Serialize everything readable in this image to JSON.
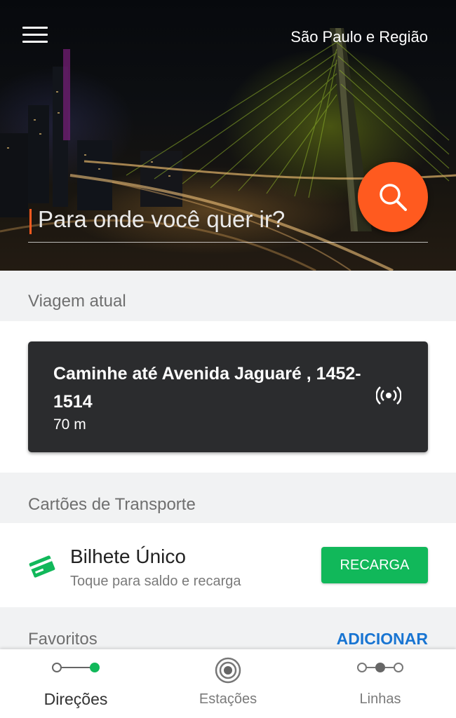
{
  "header": {
    "menu_icon": "hamburger-menu-icon",
    "region": "São Paulo e Região"
  },
  "search": {
    "placeholder": "Para onde você quer ir?",
    "button_icon": "search-icon",
    "accent": "#ff5a1f"
  },
  "current_trip": {
    "section_title": "Viagem atual",
    "instruction": "Caminhe até Avenida Jaguaré , 1452-1514",
    "distance": "70 m",
    "icon": "broadcast-icon"
  },
  "transport_cards": {
    "section_title": "Cartões de Transporte",
    "items": [
      {
        "icon": "credit-card-icon",
        "name": "Bilhete Único",
        "subtitle": "Toque para saldo e recarga",
        "action_label": "RECARGA",
        "action_color": "#11b85a"
      }
    ]
  },
  "favorites": {
    "section_title": "Favoritos",
    "add_label": "ADICIONAR",
    "link_color": "#1975d2"
  },
  "bottom_nav": {
    "items": [
      {
        "label": "Direções",
        "icon": "route-icon",
        "active": true
      },
      {
        "label": "Estações",
        "icon": "station-icon",
        "active": false
      },
      {
        "label": "Linhas",
        "icon": "lines-icon",
        "active": false
      }
    ]
  }
}
